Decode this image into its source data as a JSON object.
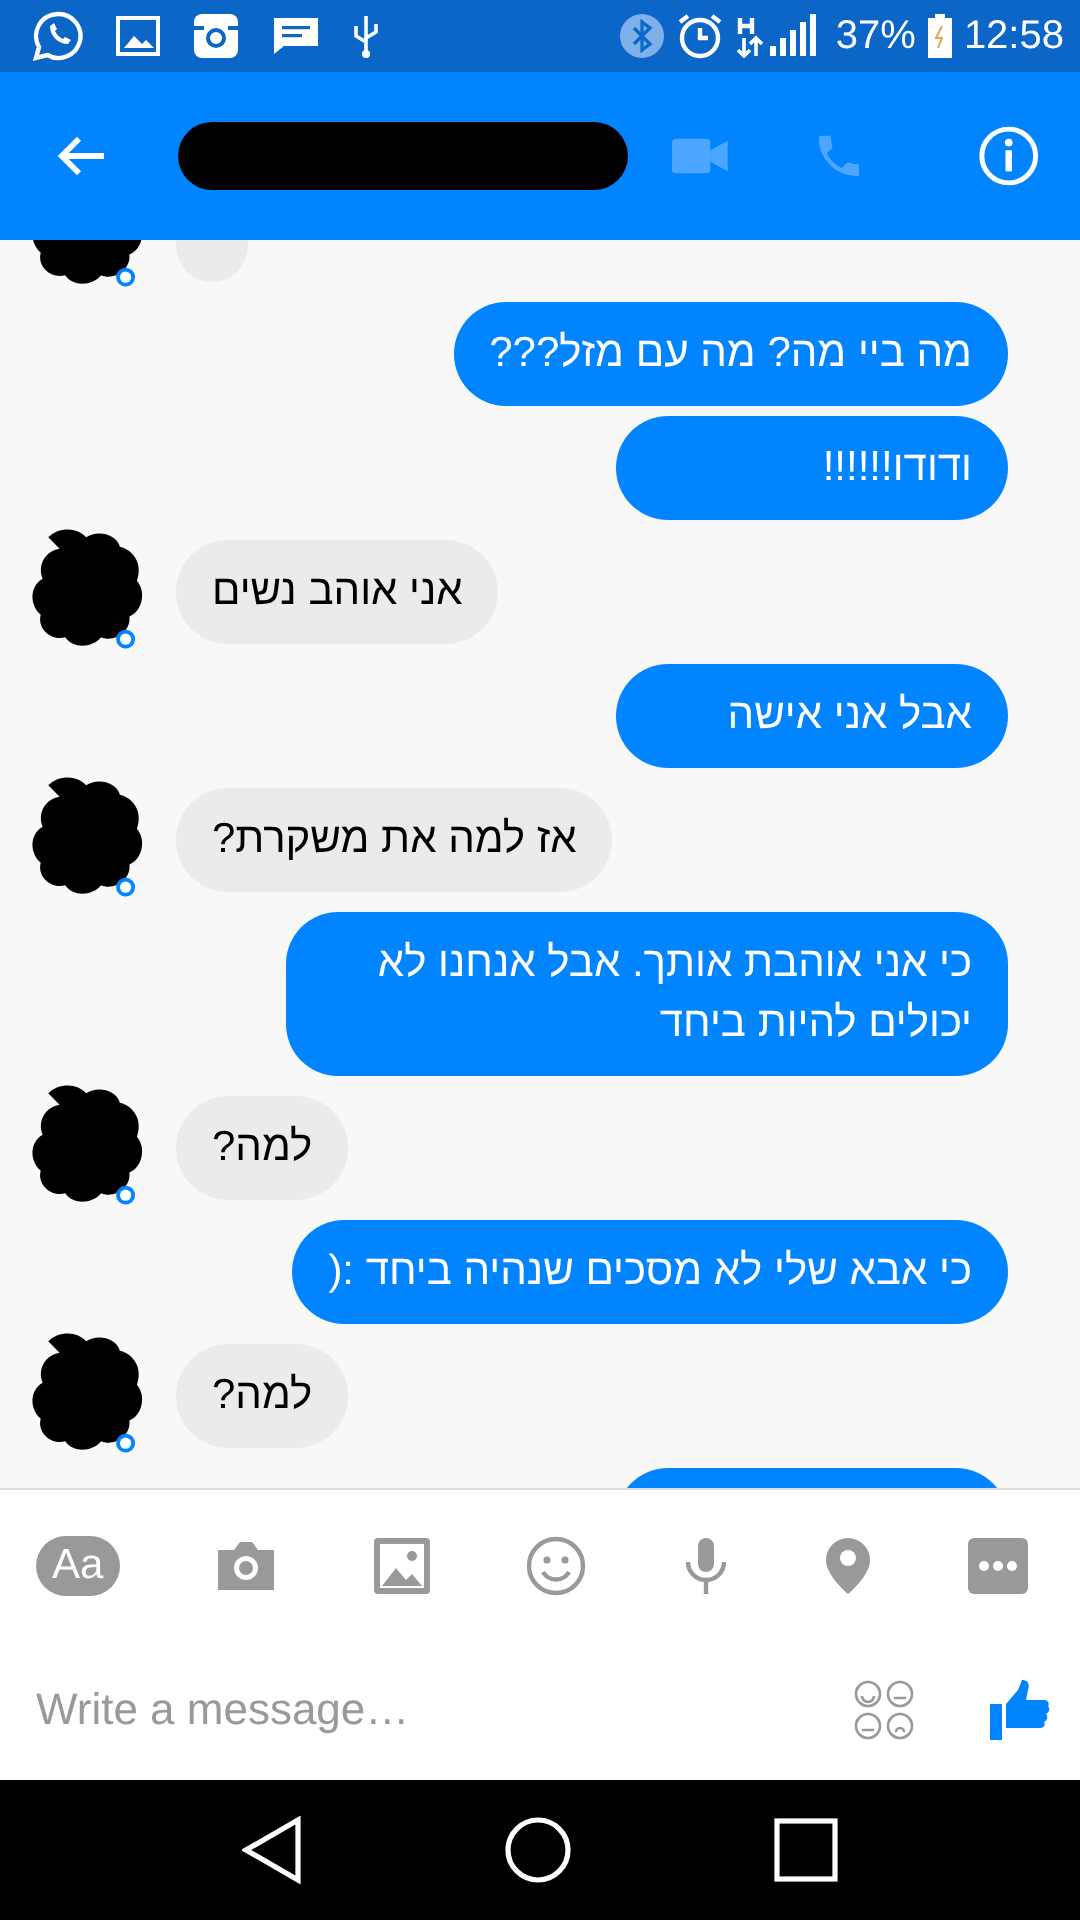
{
  "status_bar": {
    "battery": "37%",
    "time": "12:58"
  },
  "messages": [
    {
      "kind": "received"
    },
    {
      "kind": "sent",
      "text": "מה ביי מה? מה עם מזל???"
    },
    {
      "kind": "sent",
      "text": "ודודו!!!!!!"
    },
    {
      "kind": "received",
      "text": "אני אוהב נשים"
    },
    {
      "kind": "sent",
      "text": "אבל אני אישה"
    },
    {
      "kind": "received",
      "text": "אז למה את משקרת?"
    },
    {
      "kind": "sent",
      "text": "כי אני אוהבת אותך. אבל אנחנו לא יכולים להיות ביחד"
    },
    {
      "kind": "received",
      "text": "למה?"
    },
    {
      "kind": "sent",
      "text": "כי אבא שלי לא מסכים שנהיה ביחד :("
    },
    {
      "kind": "received",
      "text": "למה?"
    },
    {
      "kind": "sent"
    }
  ],
  "toolbar": {
    "text_style_label": "Aa"
  },
  "composer": {
    "placeholder": "Write a message…"
  }
}
